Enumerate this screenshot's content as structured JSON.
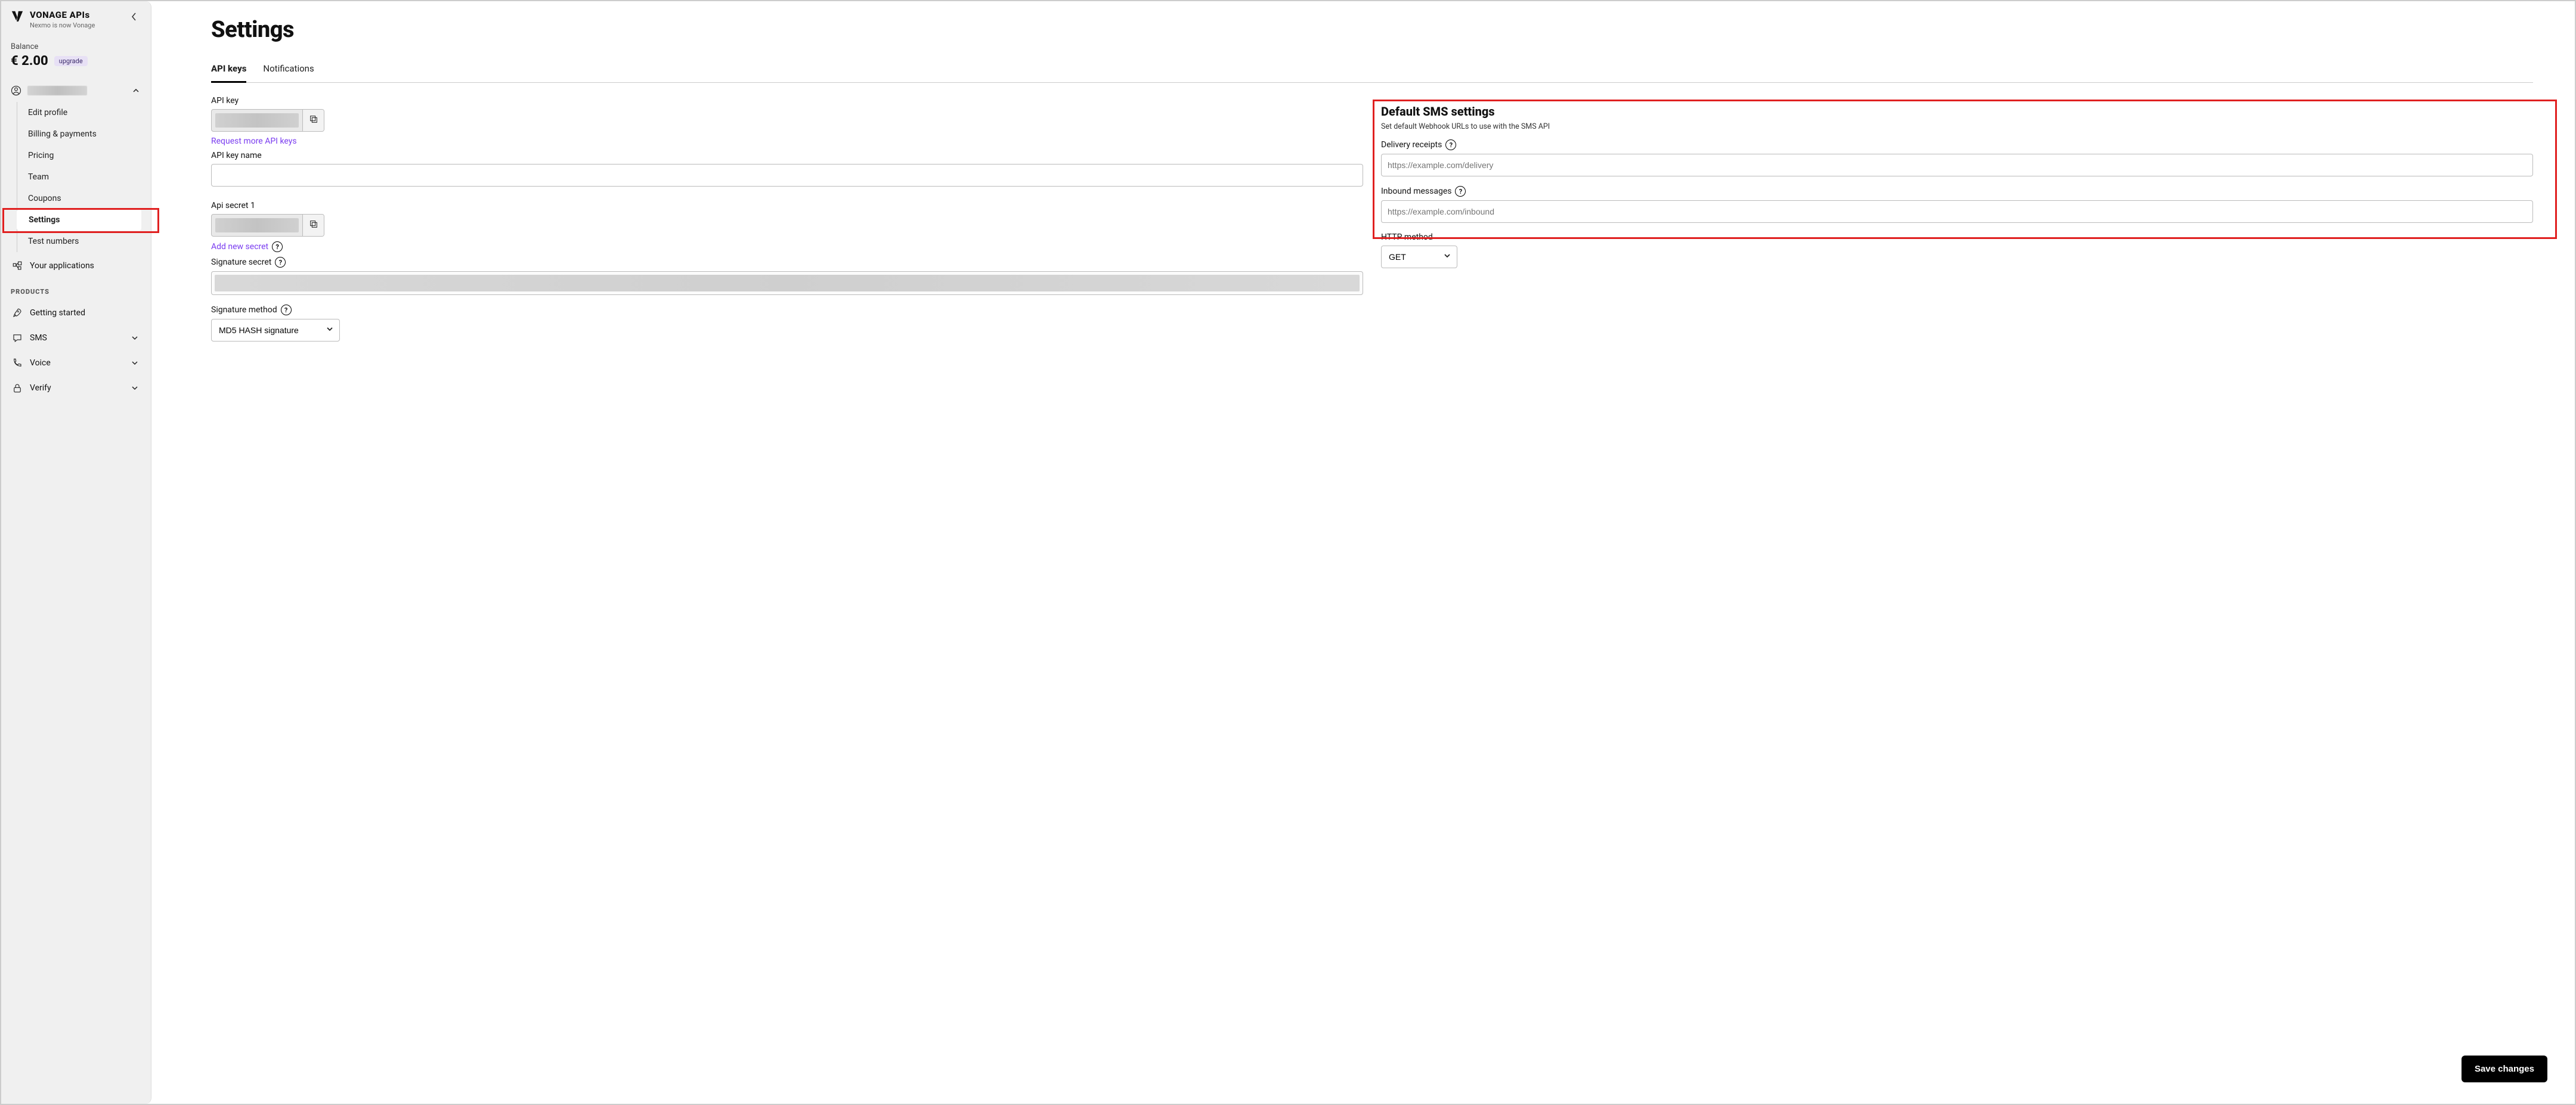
{
  "brand": {
    "title": "VONAGE APIs",
    "subtitle": "Nexmo is now Vonage"
  },
  "balance": {
    "label": "Balance",
    "amount": "€ 2.00",
    "upgrade": "upgrade"
  },
  "subnav": {
    "items": [
      "Edit profile",
      "Billing & payments",
      "Pricing",
      "Team",
      "Coupons",
      "Settings",
      "Test numbers"
    ],
    "activeIndex": 5
  },
  "nav": {
    "yourApps": "Your applications",
    "productsHeader": "PRODUCTS",
    "products": [
      "Getting started",
      "SMS",
      "Voice",
      "Verify"
    ]
  },
  "page": {
    "title": "Settings"
  },
  "tabs": {
    "items": [
      "API keys",
      "Notifications"
    ],
    "activeIndex": 0
  },
  "left": {
    "apiKeyLabel": "API key",
    "requestMore": "Request more API keys",
    "apiKeyNameLabel": "API key name",
    "apiKeyNameValue": "",
    "apiSecretLabel": "Api secret 1",
    "addSecret": "Add new secret",
    "sigSecretLabel": "Signature secret",
    "sigMethodLabel": "Signature method",
    "sigMethodValue": "MD5 HASH signature"
  },
  "right": {
    "title": "Default SMS settings",
    "subtitle": "Set default Webhook URLs to use with the SMS API",
    "deliveryLabel": "Delivery receipts",
    "deliveryPlaceholder": "https://example.com/delivery",
    "inboundLabel": "Inbound messages",
    "inboundPlaceholder": "https://example.com/inbound",
    "httpMethodLabel": "HTTP method",
    "httpMethodValue": "GET"
  },
  "save": "Save changes"
}
